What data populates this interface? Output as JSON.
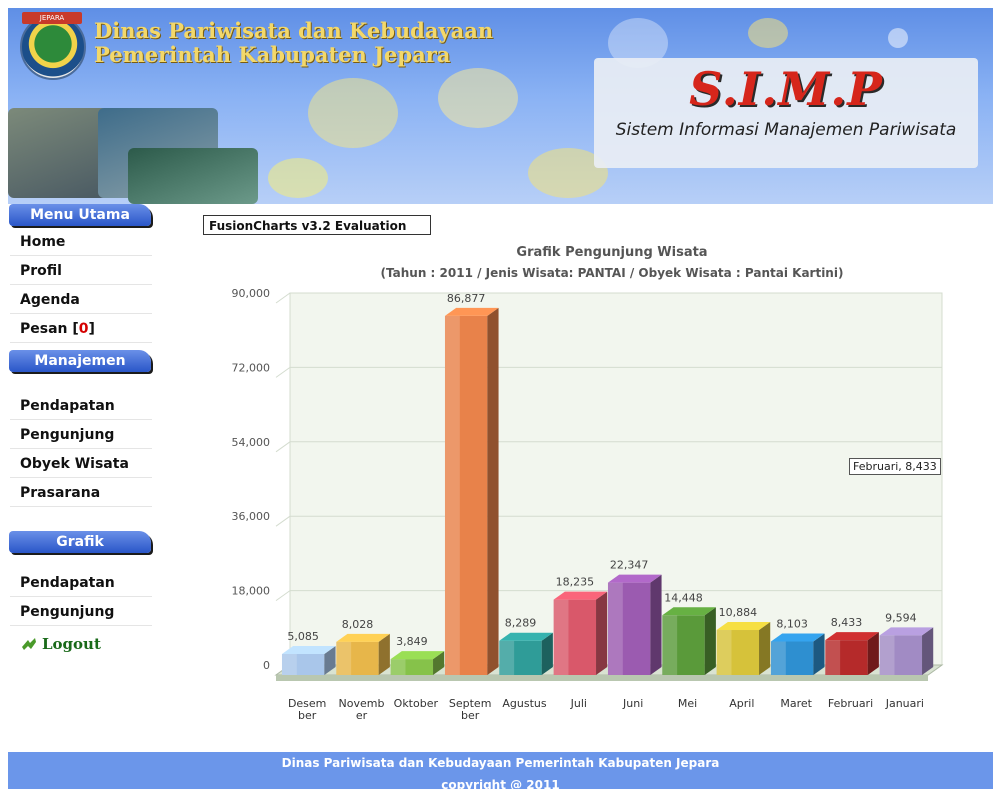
{
  "header": {
    "logo_text": "JEPARA",
    "title_line1": "Dinas Pariwisata dan Kebudayaan",
    "title_line2": "Pemerintah Kabupaten Jepara",
    "app_abbrev": "S.I.M.P",
    "app_subtitle": "Sistem Informasi Manajemen Pariwisata"
  },
  "sidebar": {
    "sections": [
      {
        "title": "Menu Utama",
        "items": [
          "Home",
          "Profil",
          "Agenda"
        ]
      },
      {
        "title": "Manajemen",
        "items": [
          "Pendapatan",
          "Pengunjung",
          "Obyek Wisata",
          "Prasarana"
        ]
      },
      {
        "title": "Grafik",
        "items": [
          "Pendapatan",
          "Pengunjung"
        ]
      }
    ],
    "pesan_label": "Pesan [",
    "pesan_count": "0",
    "pesan_close": "]",
    "logout_label": "Logout"
  },
  "chart_meta": {
    "evaluation_banner": "FusionCharts v3.2 Evaluation",
    "tooltip": "Februari, 8,433"
  },
  "chart_data": {
    "type": "bar",
    "title": "Grafik Pengunjung Wisata",
    "subtitle": "(Tahun : 2011 / Jenis Wisata: PANTAI / Obyek Wisata : Pantai Kartini)",
    "categories": [
      "Desember",
      "November",
      "Oktober",
      "September",
      "Agustus",
      "Juli",
      "Juni",
      "Mei",
      "April",
      "Maret",
      "Februari",
      "Januari"
    ],
    "category_label_lines": [
      [
        "Desem",
        "ber"
      ],
      [
        "Novemb",
        "er"
      ],
      [
        "Oktober"
      ],
      [
        "Septem",
        "ber"
      ],
      [
        "Agustus"
      ],
      [
        "Juli"
      ],
      [
        "Juni"
      ],
      [
        "Mei"
      ],
      [
        "April"
      ],
      [
        "Maret"
      ],
      [
        "Februari"
      ],
      [
        "Januari"
      ]
    ],
    "values": [
      5085,
      8028,
      3849,
      86877,
      8289,
      18235,
      22347,
      14448,
      10884,
      8103,
      8433,
      9594
    ],
    "value_labels": [
      "5,085",
      "8,028",
      "3,849",
      "86,877",
      "8,289",
      "18,235",
      "22,347",
      "14,448",
      "10,884",
      "8,103",
      "8,433",
      "9,594"
    ],
    "colors": [
      "#a9c6ea",
      "#e7b64a",
      "#86c24a",
      "#e8824a",
      "#2f9c98",
      "#d9586a",
      "#9b5bb0",
      "#5a9a3a",
      "#d6c23a",
      "#2e8fd0",
      "#b52a2a",
      "#a18bc4"
    ],
    "ylim": [
      0,
      90000
    ],
    "yticks": [
      0,
      18000,
      36000,
      54000,
      72000,
      90000
    ],
    "ytick_labels": [
      "0",
      "18,000",
      "36,000",
      "54,000",
      "72,000",
      "90,000"
    ],
    "grid": true
  },
  "footer": {
    "line1": "Dinas Pariwisata dan Kebudayaan Pemerintah Kabupaten Jepara",
    "line2": "copyright @ 2011"
  }
}
